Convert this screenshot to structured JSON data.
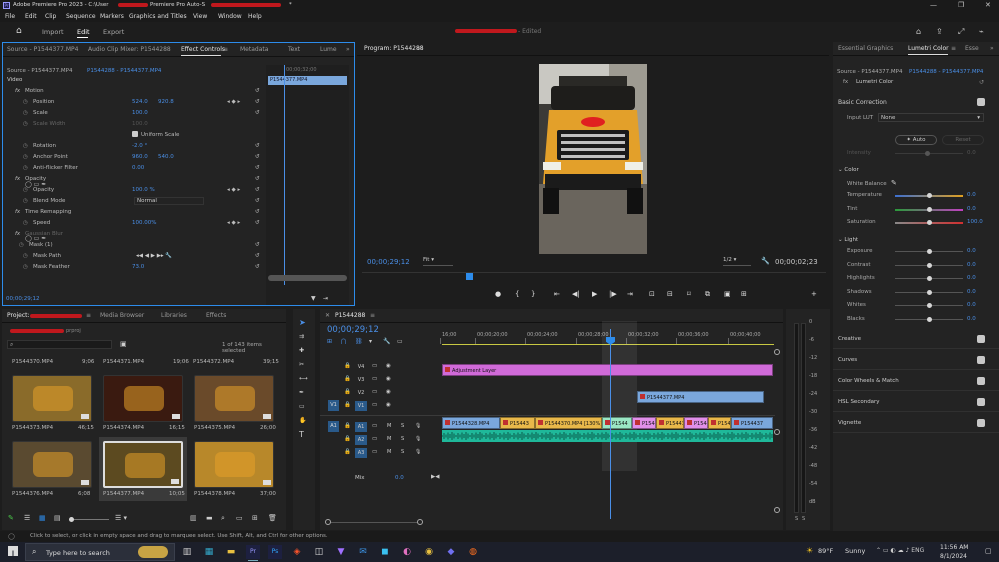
{
  "app": {
    "title": "Adobe Premiere Pro 2023 - C:\\User",
    "title_tail": "Premiere Pro Auto-S",
    "title_end": "*",
    "menu": [
      "File",
      "Edit",
      "Clip",
      "Sequence",
      "Markers",
      "Graphics and Titles",
      "View",
      "Window",
      "Help"
    ]
  },
  "workspace": {
    "tabs": [
      "Import",
      "Edit",
      "Export"
    ],
    "active": "Edit",
    "center_suffix": "- Edited"
  },
  "effect_controls": {
    "tabs": [
      "Source - P1544377.MP4",
      "Audio Clip Mixer: P1544288",
      "Effect Controls",
      "Metadata",
      "Text",
      "Lume"
    ],
    "source": "Source - P1544377.MP4",
    "seq": "P1544288 - P1544377.MP4",
    "clipname": "P1544377.MP4",
    "ruler_time": "00;00;32;00",
    "section_video": "Video",
    "rows": [
      {
        "fx": "fx",
        "label": "Motion"
      },
      {
        "label": "Position",
        "v1": "524.0",
        "v2": "920.8"
      },
      {
        "label": "Scale",
        "v1": "100.0"
      },
      {
        "label": "Scale Width",
        "v1": "100.0"
      },
      {
        "label": "Uniform Scale"
      },
      {
        "label": "Rotation",
        "v1": "-2.0 °"
      },
      {
        "label": "Anchor Point",
        "v1": "960.0",
        "v2": "540.0"
      },
      {
        "label": "Anti-flicker Filter",
        "v1": "0.00"
      },
      {
        "fx": "fx",
        "label": "Opacity"
      },
      {
        "label": "Opacity",
        "v1": "100.0 %"
      },
      {
        "label": "Blend Mode",
        "v1": "Normal"
      },
      {
        "fx": "fx",
        "label": "Time Remapping"
      },
      {
        "label": "Speed",
        "v1": "100.00%"
      },
      {
        "fx": "fx",
        "label": "Gaussian Blur"
      },
      {
        "label": "Mask (1)"
      },
      {
        "label": "Mask Path"
      },
      {
        "label": "Mask Feather",
        "v1": "73.0"
      }
    ],
    "timecode": "00;00;29;12"
  },
  "program": {
    "title": "Program: P1544288",
    "timecode": "00;00;29;12",
    "fit": "Fit",
    "resolution": "1/2",
    "duration": "00;00;02;23"
  },
  "lumetri": {
    "tabs": [
      "Essential Graphics",
      "Lumetri Color",
      "Esse"
    ],
    "source": "Source - P1544377.MP4",
    "seq": "P1544288 - P1544377.MP4",
    "effect": "Lumetri Color",
    "basic_correction": "Basic Correction",
    "input_lut": "Input LUT",
    "lut_value": "None",
    "auto": "Auto",
    "reset": "Reset",
    "intensity": "Intensity",
    "intensity_val": "0.0",
    "color": "Color",
    "white_balance": "White Balance",
    "sliders_color": [
      {
        "label": "Temperature",
        "val": "0.0"
      },
      {
        "label": "Tint",
        "val": "0.0"
      },
      {
        "label": "Saturation",
        "val": "100.0"
      }
    ],
    "light": "Light",
    "sliders_light": [
      {
        "label": "Exposure",
        "val": "0.0"
      },
      {
        "label": "Contrast",
        "val": "0.0"
      },
      {
        "label": "Highlights",
        "val": "0.0"
      },
      {
        "label": "Shadows",
        "val": "0.0"
      },
      {
        "label": "Whites",
        "val": "0.0"
      },
      {
        "label": "Blacks",
        "val": "0.0"
      }
    ],
    "sections": [
      "Creative",
      "Curves",
      "Color Wheels & Match",
      "HSL Secondary",
      "Vignette"
    ]
  },
  "project": {
    "tabs": [
      "Project:",
      "Media Browser",
      "Libraries",
      "Effects"
    ],
    "extension": "prproj",
    "count": "1 of 143 items selected",
    "items_top": [
      {
        "name": "P1544370.MP4",
        "dur": "9;06"
      },
      {
        "name": "P1544371.MP4",
        "dur": "19;06"
      },
      {
        "name": "P1544372.MP4",
        "dur": "39;15"
      }
    ],
    "items": [
      {
        "name": "P1544373.MP4",
        "dur": "46;15"
      },
      {
        "name": "P1544374.MP4",
        "dur": "16;15"
      },
      {
        "name": "P1544375.MP4",
        "dur": "26;00"
      },
      {
        "name": "P1544376.MP4",
        "dur": "6;08"
      },
      {
        "name": "P1544377.MP4",
        "dur": "10;05"
      },
      {
        "name": "P1544378.MP4",
        "dur": "37;00"
      }
    ]
  },
  "timeline": {
    "seq": "P1544288",
    "timecode": "00;00;29;12",
    "ruler": [
      "16;00",
      "00;00;20;00",
      "00;00;24;00",
      "00;00;28;00",
      "00;00;32;00",
      "00;00;36;00",
      "00;00;40;00"
    ],
    "tracks_video": [
      "V4",
      "V3",
      "V2",
      "V1"
    ],
    "tracks_audio": [
      "A1",
      "A2",
      "A3"
    ],
    "mix": "Mix",
    "mix_val": "0.0",
    "clips": [
      {
        "label": "Adjustment Layer",
        "color": "#d06ad8"
      },
      {
        "label": "P1544377.MP4",
        "color": "#7aa7dc"
      },
      {
        "label": "P1544328.MP4",
        "color": "#7aa7dc"
      },
      {
        "label": "P15443",
        "color": "#e8b84a"
      },
      {
        "label": "P1544370.MP4 [130%]",
        "color": "#e8b84a"
      },
      {
        "label": "P1544",
        "color": "#9ae6c4"
      },
      {
        "label": "P15442",
        "color": "#e08fe8"
      },
      {
        "label": "P15443",
        "color": "#e8b84a"
      },
      {
        "label": "P15443",
        "color": "#e08fe8"
      },
      {
        "label": "P15443",
        "color": "#e8b84a"
      },
      {
        "label": "P154437",
        "color": "#7aa7dc"
      }
    ],
    "meter_labels": [
      "0",
      "-6",
      "-12",
      "-18",
      "-24",
      "-30",
      "-36",
      "-42",
      "-48",
      "-54",
      "dB"
    ],
    "meter_bottom": [
      "S",
      "S"
    ]
  },
  "status": {
    "text": "Click to select, or click in empty space and drag to marquee select. Use Shift, Alt, and Ctrl for other options."
  },
  "taskbar": {
    "search": "Type here to search",
    "weather": "89°F",
    "weather_desc": "Sunny",
    "time": "11:56 AM",
    "date": "8/1/2024"
  },
  "colors": {
    "accent": "#2d8ceb",
    "playhead": "#4a8fe7",
    "adjustment": "#d06ad8",
    "audio": "#1fb89a"
  }
}
